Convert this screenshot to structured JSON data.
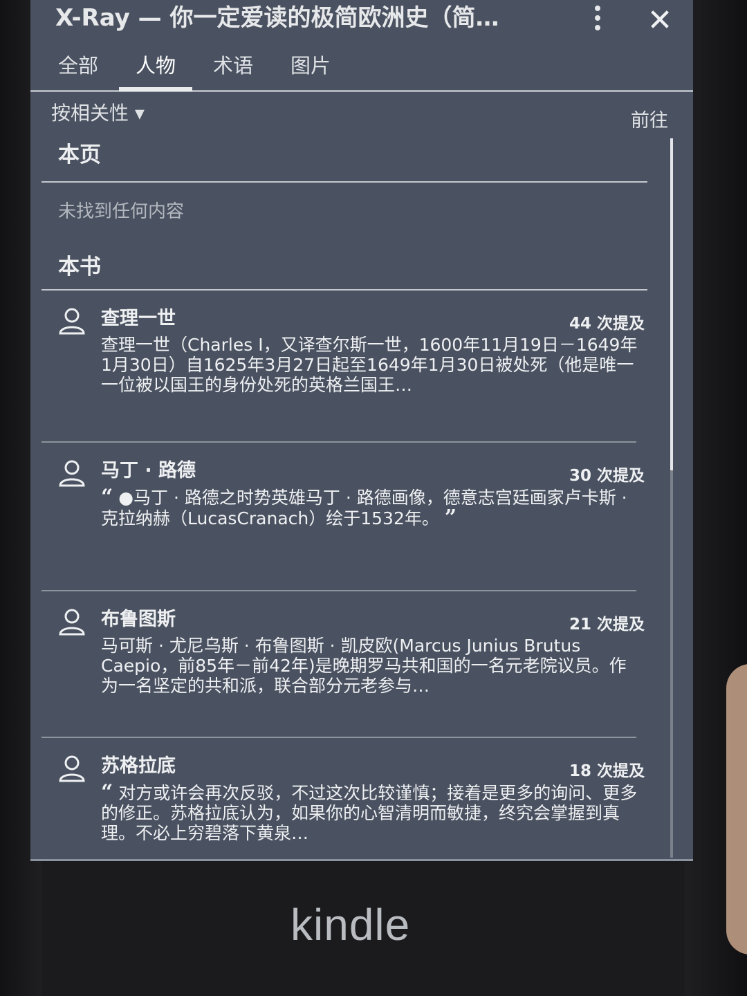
{
  "header": {
    "title": "X-Ray — 你一定爱读的极简欧洲史（简…",
    "tabs": [
      {
        "label": "全部"
      },
      {
        "label": "人物"
      },
      {
        "label": "术语"
      },
      {
        "label": "图片"
      }
    ],
    "active_tab": "人物"
  },
  "controls": {
    "sort_label": "按相关性 ▾",
    "goto_label": "前往"
  },
  "sections": {
    "this_page": {
      "title": "本页",
      "empty_text": "未找到任何内容"
    },
    "this_book": {
      "title": "本书"
    }
  },
  "entries": [
    {
      "name": "查理一世",
      "mentions": "44 次提及",
      "quoted": false,
      "text": "查理一世（Charles I，又译查尔斯一世，1600年11月19日－1649年1月30日）自1625年3月27日起至1649年1月30日被处死（他是唯一一位被以国王的身份处死的英格兰国王…"
    },
    {
      "name": "马丁 · 路德",
      "mentions": "30 次提及",
      "quoted": true,
      "open_quote": "“",
      "close_quote": "”",
      "text": "●马丁 · 路德之时势英雄马丁 · 路德画像，德意志宫廷画家卢卡斯 · 克拉纳赫（LucasCranach）绘于1532年。"
    },
    {
      "name": "布鲁图斯",
      "mentions": "21 次提及",
      "quoted": false,
      "text": "马可斯 · 尤尼乌斯 · 布鲁图斯 · 凯皮欧(Marcus Junius Brutus Caepio，前85年－前42年)是晚期罗马共和国的一名元老院议员。作为一名坚定的共和派，联合部分元老参与…"
    },
    {
      "name": "苏格拉底",
      "mentions": "18 次提及",
      "quoted": true,
      "open_quote": "“",
      "close_quote": "",
      "text": "对方或许会再次反驳，不过这次比较谨慎；接着是更多的询问、更多的修正。苏格拉底认为，如果你的心智清明而敏捷，终究会掌握到真理。不必上穷碧落下黄泉…"
    }
  ],
  "device": {
    "brand": "kindle"
  }
}
